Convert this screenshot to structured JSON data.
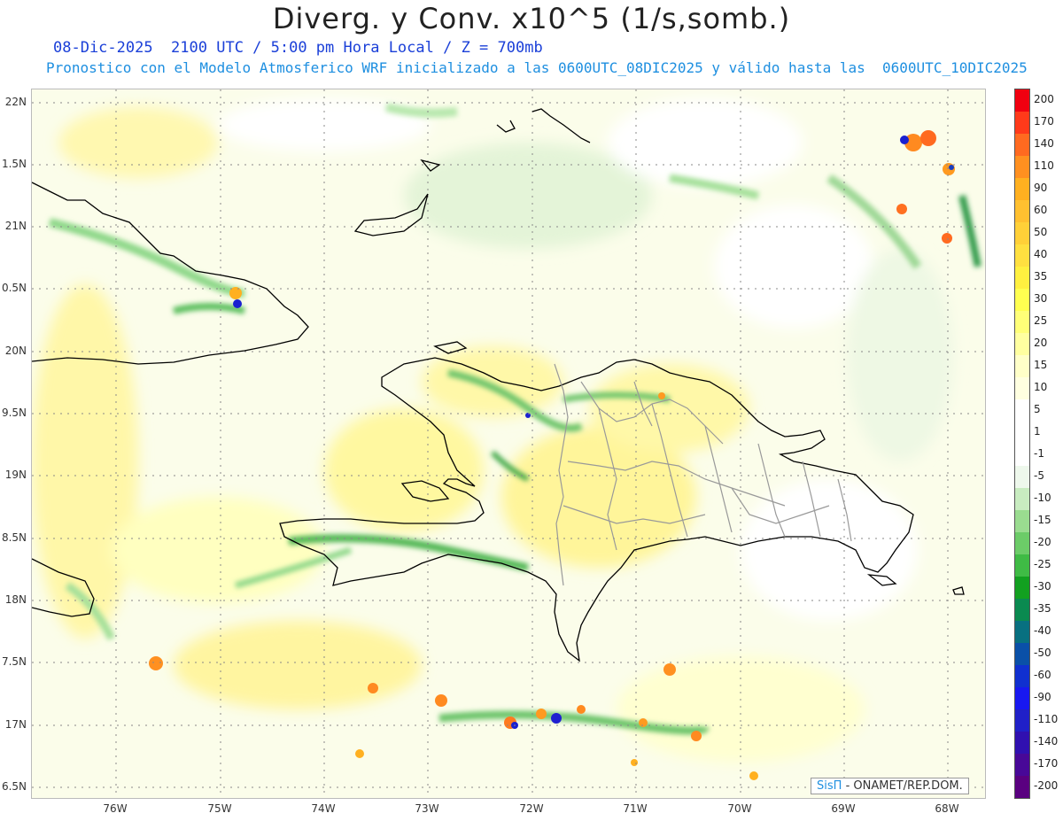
{
  "title": "Diverg. y Conv. x10^5 (1/s,somb.)",
  "subtitle_line1": "08-Dic-2025  2100 UTC / 5:00 pm Hora Local / Z = 700mb",
  "subtitle_line2": "Pronostico con el Modelo Atmosferico WRF inicializado a las 0600UTC_08DIC2025 y válido hasta las  0600UTC_10DIC2025",
  "lat_labels": [
    "22N",
    "1.5N",
    "21N",
    "0.5N",
    "20N",
    "9.5N",
    "19N",
    "8.5N",
    "18N",
    "7.5N",
    "17N",
    "6.5N"
  ],
  "lon_labels": [
    "76W",
    "75W",
    "74W",
    "73W",
    "72W",
    "71W",
    "70W",
    "69W",
    "68W"
  ],
  "colorbar": {
    "labels": [
      "200",
      "170",
      "140",
      "110",
      "90",
      "60",
      "50",
      "40",
      "35",
      "30",
      "25",
      "20",
      "15",
      "10",
      "5",
      "1",
      "-1",
      "-5",
      "-10",
      "-15",
      "-20",
      "-25",
      "-30",
      "-35",
      "-40",
      "-50",
      "-60",
      "-90",
      "-110",
      "-140",
      "-170",
      "-200"
    ],
    "colors": [
      "#f00010",
      "#ff3a1a",
      "#ff6a20",
      "#ff9020",
      "#ffb020",
      "#ffc030",
      "#ffd038",
      "#ffe040",
      "#fff040",
      "#ffff50",
      "#ffff78",
      "#ffffa0",
      "#ffffc8",
      "#ffffe0",
      "#ffffff",
      "#ffffff",
      "#ffffff",
      "#eef8ec",
      "#c8ecc0",
      "#9adc90",
      "#6ccc68",
      "#3fbb45",
      "#12a020",
      "#0a8a50",
      "#087080",
      "#0a50a8",
      "#1030d0",
      "#1818f0",
      "#2020c8",
      "#3010b0",
      "#480898",
      "#5a0080"
    ]
  },
  "credit": {
    "brand": "SisΠ",
    "text": "- ONAMET/REP.DOM."
  }
}
